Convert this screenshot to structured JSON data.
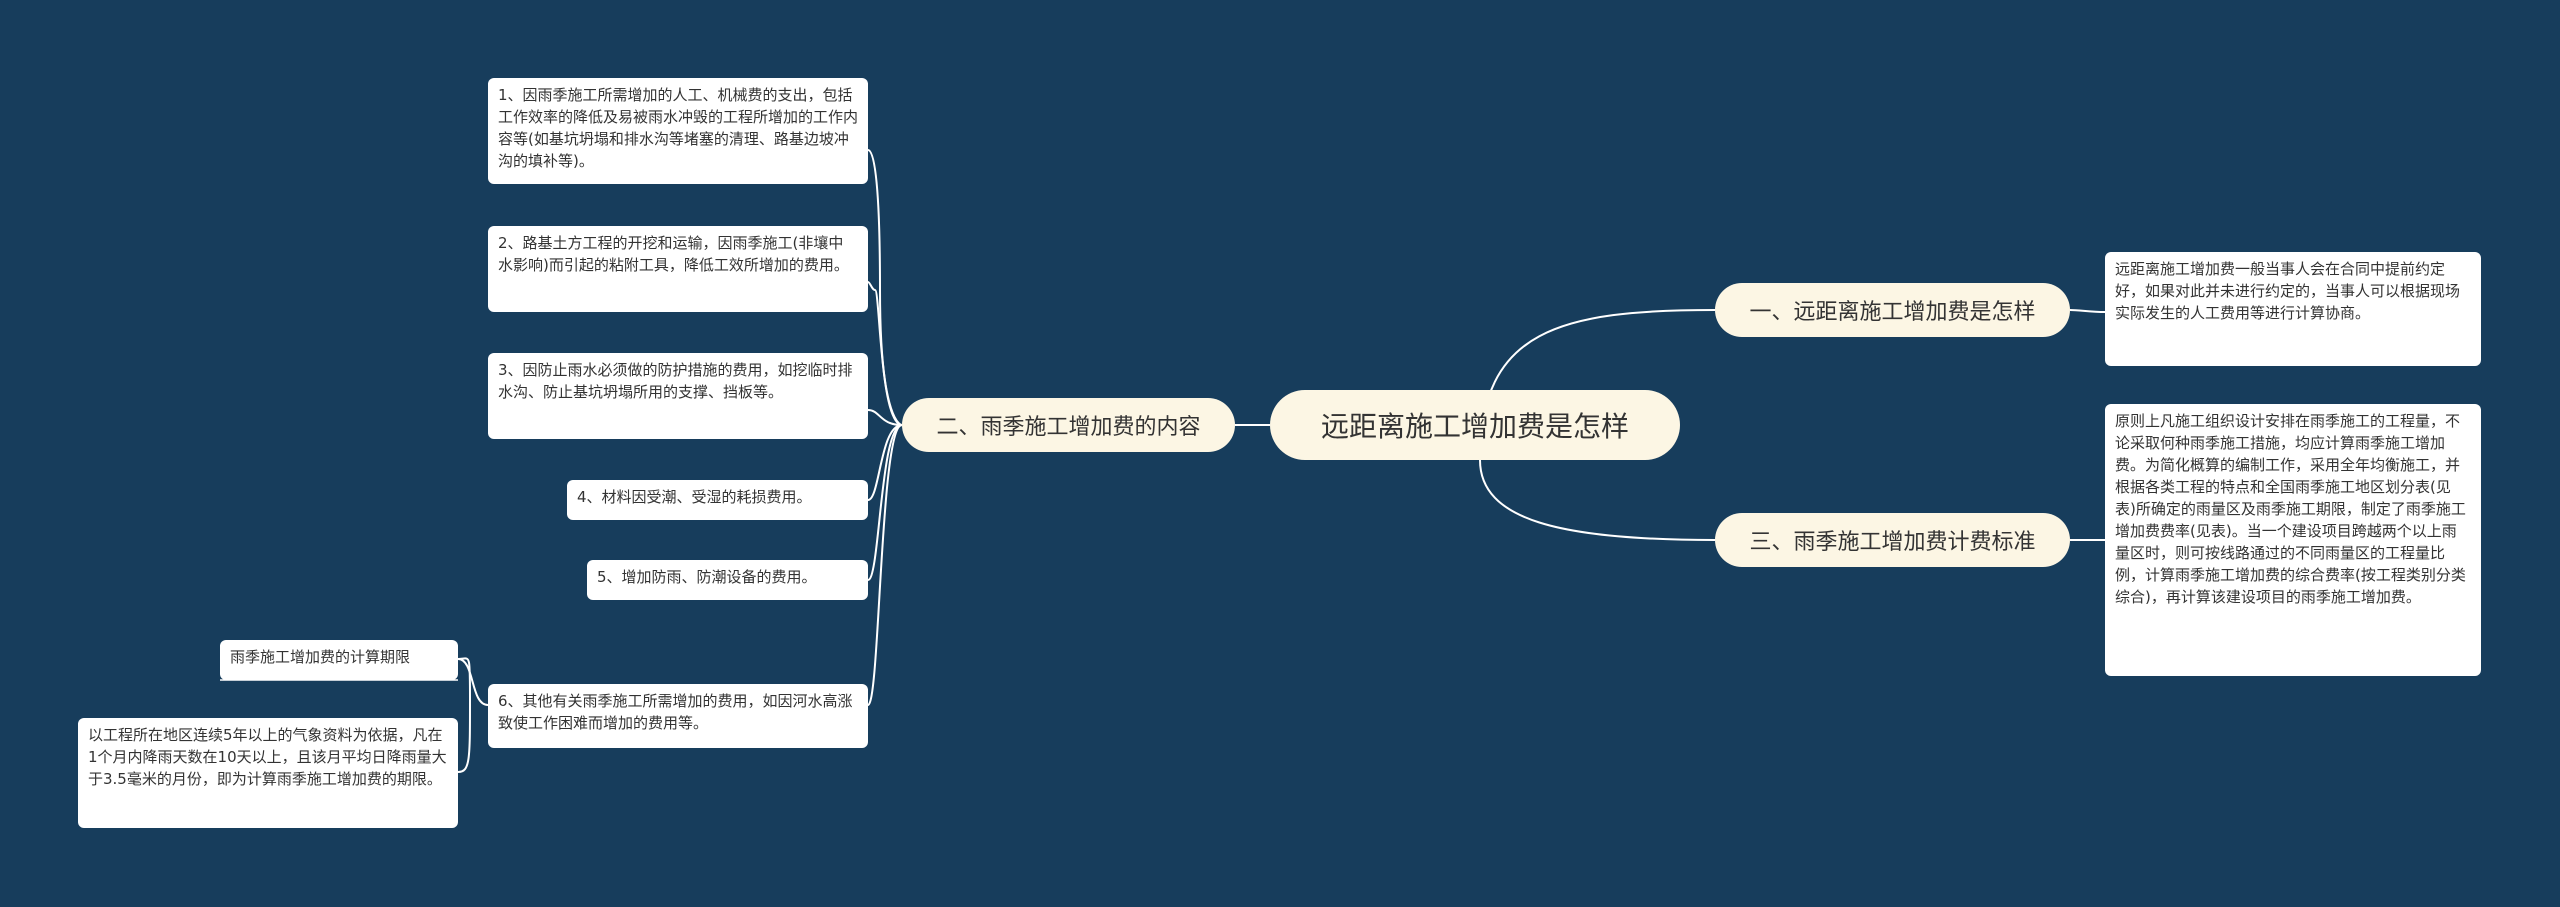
{
  "root": {
    "label": "远距离施工增加费是怎样"
  },
  "branches": {
    "b1": {
      "label": "一、远距离施工增加费是怎样",
      "leaf": "远距离施工增加费一般当事人会在合同中提前约定好，如果对此并未进行约定的，当事人可以根据现场实际发生的人工费用等进行计算协商。"
    },
    "b2": {
      "label": "二、雨季施工增加费的内容",
      "items": [
        "1、因雨季施工所需增加的人工、机械费的支出，包括工作效率的降低及易被雨水冲毁的工程所增加的工作内容等(如基坑坍塌和排水沟等堵塞的清理、路基边坡冲沟的填补等)。",
        "2、路基土方工程的开挖和运输，因雨季施工(非壤中水影响)而引起的粘附工具，降低工效所增加的费用。",
        "3、因防止雨水必须做的防护措施的费用，如挖临时排水沟、防止基坑坍塌所用的支撑、挡板等。",
        "4、材料因受潮、受湿的耗损费用。",
        "5、增加防雨、防潮设备的费用。",
        "6、其他有关雨季施工所需增加的费用，如因河水高涨致使工作困难而增加的费用等。"
      ],
      "sub": {
        "title": "雨季施工增加费的计算期限",
        "detail": "以工程所在地区连续5年以上的气象资料为依据，凡在1个月内降雨天数在10天以上，且该月平均日降雨量大于3.5毫米的月份，即为计算雨季施工增加费的期限。"
      }
    },
    "b3": {
      "label": "三、雨季施工增加费计费标准",
      "leaf": "原则上凡施工组织设计安排在雨季施工的工程量，不论采取何种雨季施工措施，均应计算雨季施工增加费。为简化概算的编制工作，采用全年均衡施工，并根据各类工程的特点和全国雨季施工地区划分表(见表)所确定的雨量区及雨季施工期限，制定了雨季施工增加费费率(见表)。当一个建设项目跨越两个以上雨量区时，则可按线路通过的不同雨量区的工程量比例，计算雨季施工增加费的综合费率(按工程类别分类综合)，再计算该建设项目的雨季施工增加费。"
    }
  },
  "colors": {
    "background": "#173d5c",
    "branch_fill": "#fcf6e4",
    "leaf_fill": "#ffffff",
    "line": "#ffffff"
  }
}
